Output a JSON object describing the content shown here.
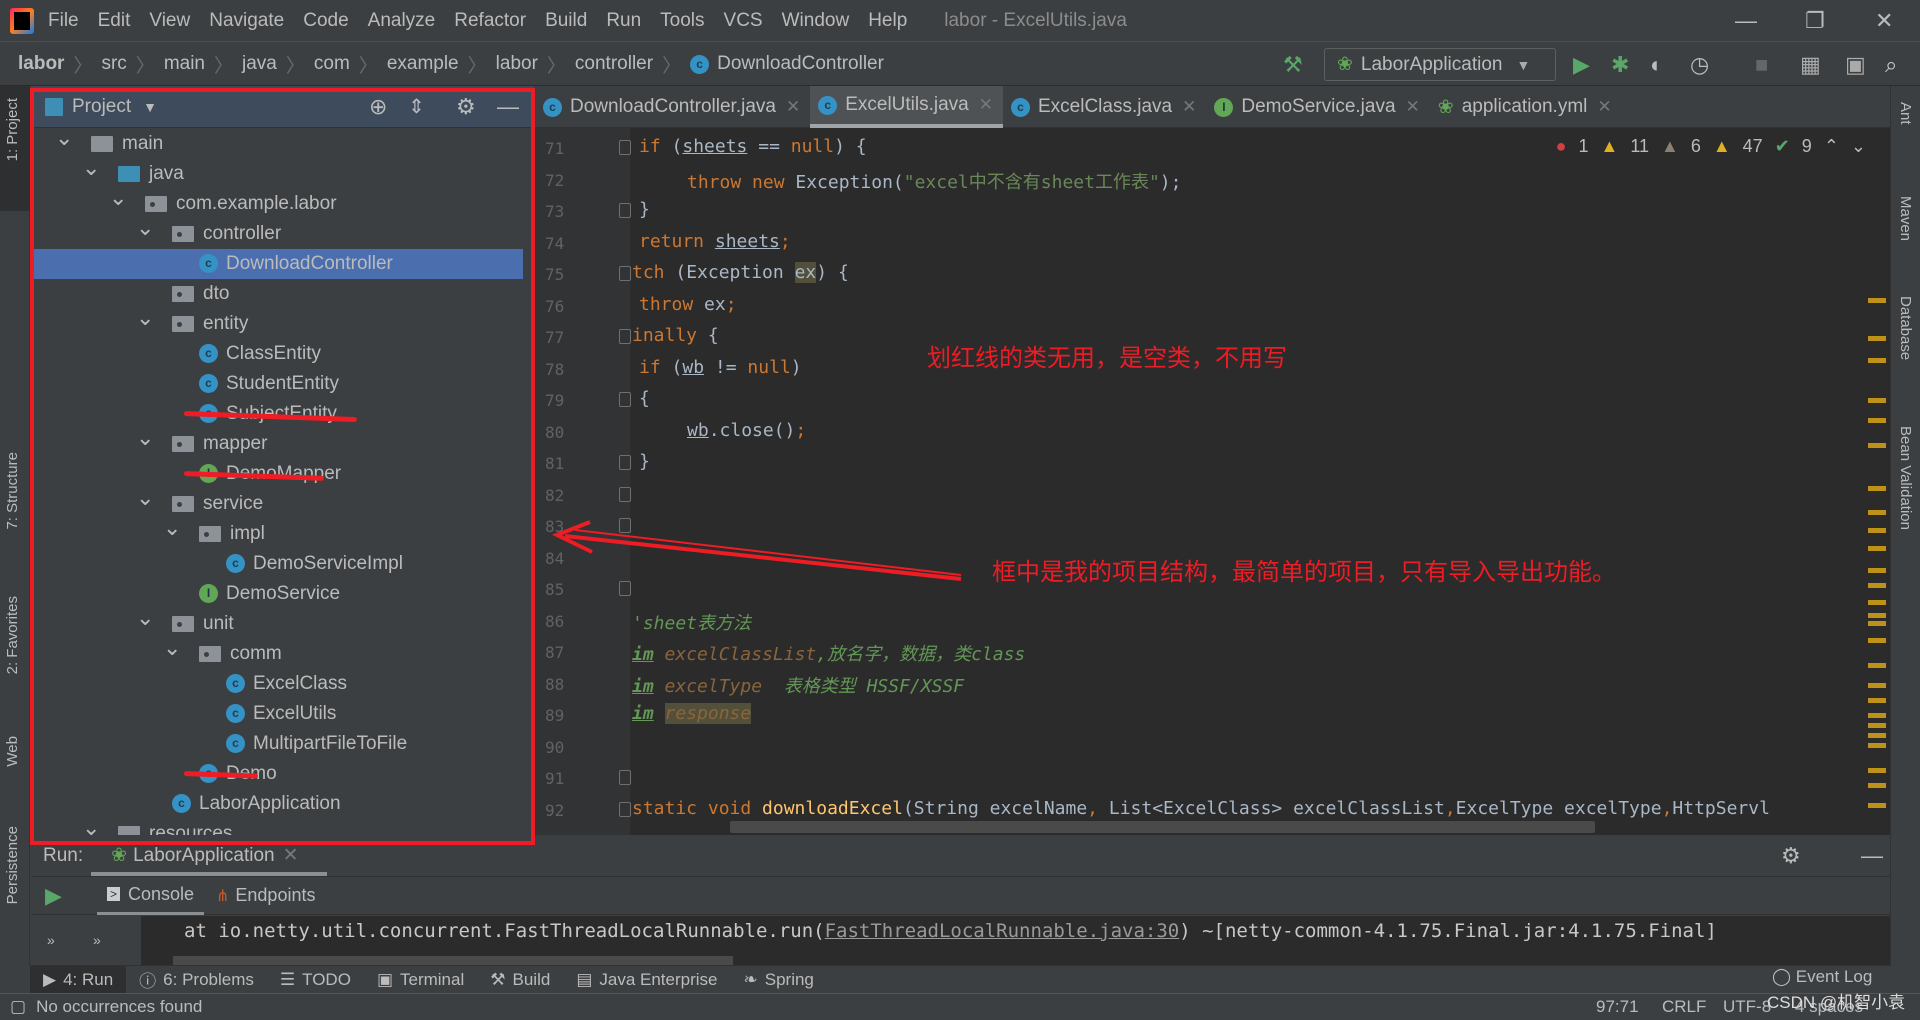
{
  "window": {
    "title": "labor - ExcelUtils.java",
    "controls": [
      "—",
      "❐",
      "✕"
    ]
  },
  "menu": [
    "File",
    "Edit",
    "View",
    "Navigate",
    "Code",
    "Analyze",
    "Refactor",
    "Build",
    "Run",
    "Tools",
    "VCS",
    "Window",
    "Help"
  ],
  "breadcrumb": [
    "labor",
    "src",
    "main",
    "java",
    "com",
    "example",
    "labor",
    "controller",
    "DownloadController"
  ],
  "run_config": {
    "label": "LaborApplication"
  },
  "left_strip": [
    "1: Project",
    "7: Structure",
    "2: Favorites",
    "Web",
    "Persistence"
  ],
  "right_strip": [
    "Ant",
    "Maven",
    "Database",
    "Bean Validation"
  ],
  "project": {
    "title": "Project",
    "tree": [
      {
        "label": "main",
        "type": "folder",
        "depth": 0,
        "expanded": true
      },
      {
        "label": "java",
        "type": "source-folder",
        "depth": 1,
        "expanded": true
      },
      {
        "label": "com.example.labor",
        "type": "package",
        "depth": 2,
        "expanded": true
      },
      {
        "label": "controller",
        "type": "package",
        "depth": 3,
        "expanded": true
      },
      {
        "label": "DownloadController",
        "type": "class",
        "depth": 4,
        "selected": true
      },
      {
        "label": "dto",
        "type": "package",
        "depth": 3
      },
      {
        "label": "entity",
        "type": "package",
        "depth": 3,
        "expanded": true
      },
      {
        "label": "ClassEntity",
        "type": "class",
        "depth": 4
      },
      {
        "label": "StudentEntity",
        "type": "class",
        "depth": 4
      },
      {
        "label": "SubjectEntity",
        "type": "class",
        "depth": 4,
        "struck": true
      },
      {
        "label": "mapper",
        "type": "package",
        "depth": 3,
        "expanded": true
      },
      {
        "label": "DemoMapper",
        "type": "interface",
        "depth": 4,
        "struck": true
      },
      {
        "label": "service",
        "type": "package",
        "depth": 3,
        "expanded": true
      },
      {
        "label": "impl",
        "type": "package",
        "depth": 4,
        "expanded": true
      },
      {
        "label": "DemoServiceImpl",
        "type": "class",
        "depth": 5
      },
      {
        "label": "DemoService",
        "type": "interface",
        "depth": 4
      },
      {
        "label": "unit",
        "type": "package",
        "depth": 3,
        "expanded": true
      },
      {
        "label": "comm",
        "type": "package",
        "depth": 4,
        "expanded": true
      },
      {
        "label": "ExcelClass",
        "type": "class",
        "depth": 5
      },
      {
        "label": "ExcelUtils",
        "type": "class",
        "depth": 5
      },
      {
        "label": "MultipartFileToFile",
        "type": "class",
        "depth": 5
      },
      {
        "label": "Demo",
        "type": "class",
        "depth": 4,
        "struck": true
      },
      {
        "label": "LaborApplication",
        "type": "spring-app",
        "depth": 3
      },
      {
        "label": "resources",
        "type": "folder",
        "depth": 1,
        "expanded": true
      }
    ]
  },
  "tabs": [
    {
      "label": "DownloadController.java",
      "icon": "class",
      "active": false
    },
    {
      "label": "ExcelUtils.java",
      "icon": "class",
      "active": true
    },
    {
      "label": "ExcelClass.java",
      "icon": "class",
      "active": false
    },
    {
      "label": "DemoService.java",
      "icon": "interface",
      "active": false
    },
    {
      "label": "application.yml",
      "icon": "spring",
      "active": false
    }
  ],
  "inspections": {
    "errors": "1",
    "warnings": "11",
    "weak_warnings": "6",
    "typos": "47",
    "ok": "9"
  },
  "code": [
    {
      "n": "71",
      "indent": 0,
      "tokens": [
        [
          "kw",
          "if "
        ],
        [
          "",
          "("
        ],
        [
          "ul",
          "sheets"
        ],
        [
          "",
          " == "
        ],
        [
          "kw",
          "null"
        ],
        [
          "",
          ") {"
        ]
      ]
    },
    {
      "n": "72",
      "indent": 1,
      "tokens": [
        [
          "kw",
          "throw new "
        ],
        [
          "",
          "Exception("
        ],
        [
          "str",
          "\"excel中不含有sheet工作表\""
        ],
        [
          "",
          ");"
        ]
      ]
    },
    {
      "n": "73",
      "indent": 0,
      "tokens": [
        [
          "",
          "}"
        ]
      ]
    },
    {
      "n": "74",
      "indent": 0,
      "tokens": [
        [
          "kw",
          "return "
        ],
        [
          "ul",
          "sheets"
        ],
        [
          "kw",
          ";"
        ]
      ]
    },
    {
      "n": "75",
      "indent": -1,
      "tokens": [
        [
          "kw",
          "tch "
        ],
        [
          "",
          "(Exception "
        ],
        [
          "hl",
          "ex"
        ],
        [
          "",
          ") {"
        ]
      ]
    },
    {
      "n": "76",
      "indent": 0,
      "tokens": [
        [
          "kw",
          "throw "
        ],
        [
          "",
          "ex"
        ],
        [
          "kw",
          ";"
        ]
      ]
    },
    {
      "n": "77",
      "indent": -1,
      "tokens": [
        [
          "kw",
          "inally "
        ],
        [
          "",
          "{"
        ]
      ]
    },
    {
      "n": "78",
      "indent": 0,
      "tokens": [
        [
          "kw",
          "if "
        ],
        [
          "",
          "("
        ],
        [
          "ul",
          "wb"
        ],
        [
          "",
          " != "
        ],
        [
          "kw",
          "null"
        ],
        [
          "",
          ")"
        ]
      ]
    },
    {
      "n": "79",
      "indent": 0,
      "tokens": [
        [
          "",
          "{"
        ]
      ]
    },
    {
      "n": "80",
      "indent": 1,
      "tokens": [
        [
          "ul",
          "wb"
        ],
        [
          "",
          ".close()"
        ],
        [
          "kw",
          ";"
        ]
      ]
    },
    {
      "n": "81",
      "indent": 0,
      "tokens": [
        [
          "",
          "}"
        ]
      ]
    },
    {
      "n": "82",
      "indent": 0,
      "tokens": []
    },
    {
      "n": "83",
      "indent": 0,
      "tokens": []
    },
    {
      "n": "84",
      "indent": 0,
      "tokens": []
    },
    {
      "n": "85",
      "indent": 0,
      "tokens": []
    },
    {
      "n": "86",
      "indent": -1,
      "tokens": [
        [
          "doc",
          "'sheet表方法"
        ]
      ]
    },
    {
      "n": "87",
      "indent": -1,
      "tokens": [
        [
          "doctag",
          "im"
        ],
        [
          "doc",
          " "
        ],
        [
          "docparam",
          "excelClassList"
        ],
        [
          "doc",
          ",放名字，数据，类class"
        ]
      ]
    },
    {
      "n": "88",
      "indent": -1,
      "tokens": [
        [
          "doctag",
          "im"
        ],
        [
          "doc",
          " "
        ],
        [
          "docparam",
          "excelType"
        ],
        [
          "doc",
          "  表格类型 HSSF/XSSF"
        ]
      ]
    },
    {
      "n": "89",
      "indent": -1,
      "tokens": [
        [
          "doctag",
          "im"
        ],
        [
          "doc",
          " "
        ],
        [
          "hl2",
          "response"
        ]
      ]
    },
    {
      "n": "90",
      "indent": 0,
      "tokens": []
    },
    {
      "n": "91",
      "indent": 0,
      "tokens": []
    },
    {
      "n": "92",
      "indent": -1,
      "tokens": [
        [
          "kw",
          "static void "
        ],
        [
          "fn",
          "downloadExcel"
        ],
        [
          "",
          "(String excelName"
        ],
        [
          "kw",
          ", "
        ],
        [
          "",
          "List<ExcelClass> excelClassList"
        ],
        [
          "kw",
          ","
        ],
        [
          "",
          "ExcelType excelType"
        ],
        [
          "kw",
          ","
        ],
        [
          "",
          "HttpServl"
        ]
      ]
    }
  ],
  "annotations": {
    "note1": "划红线的类无用，是空类，不用写",
    "note2": "框中是我的项目结构，最简单的项目，只有导入导出功能。"
  },
  "run_panel": {
    "label": "Run:",
    "tab": "LaborApplication",
    "subtabs": [
      "Console",
      "Endpoints"
    ],
    "console_prefix": "    at io.netty.util.concurrent.FastThreadLocalRunnable.run(",
    "console_link": "FastThreadLocalRunnable.java:30",
    "console_suffix": ") ~[netty-common-4.1.75.Final.jar:4.1.75.Final]"
  },
  "bottom_tabs": [
    "4: Run",
    "6: Problems",
    "TODO",
    "Terminal",
    "Build",
    "Java Enterprise",
    "Spring"
  ],
  "event_log": "Event Log",
  "status": {
    "message": "No occurrences found",
    "position": "97:71",
    "line_sep": "CRLF",
    "encoding": "UTF-8",
    "indent": "4 spaces"
  },
  "watermark": "CSDN @机智小袁",
  "colors": {
    "accent": "#4b6eaf",
    "annotation_red": "#ee1c25",
    "editor_bg": "#2b2b2b",
    "keyword": "#cc7832",
    "string": "#6a8759"
  }
}
